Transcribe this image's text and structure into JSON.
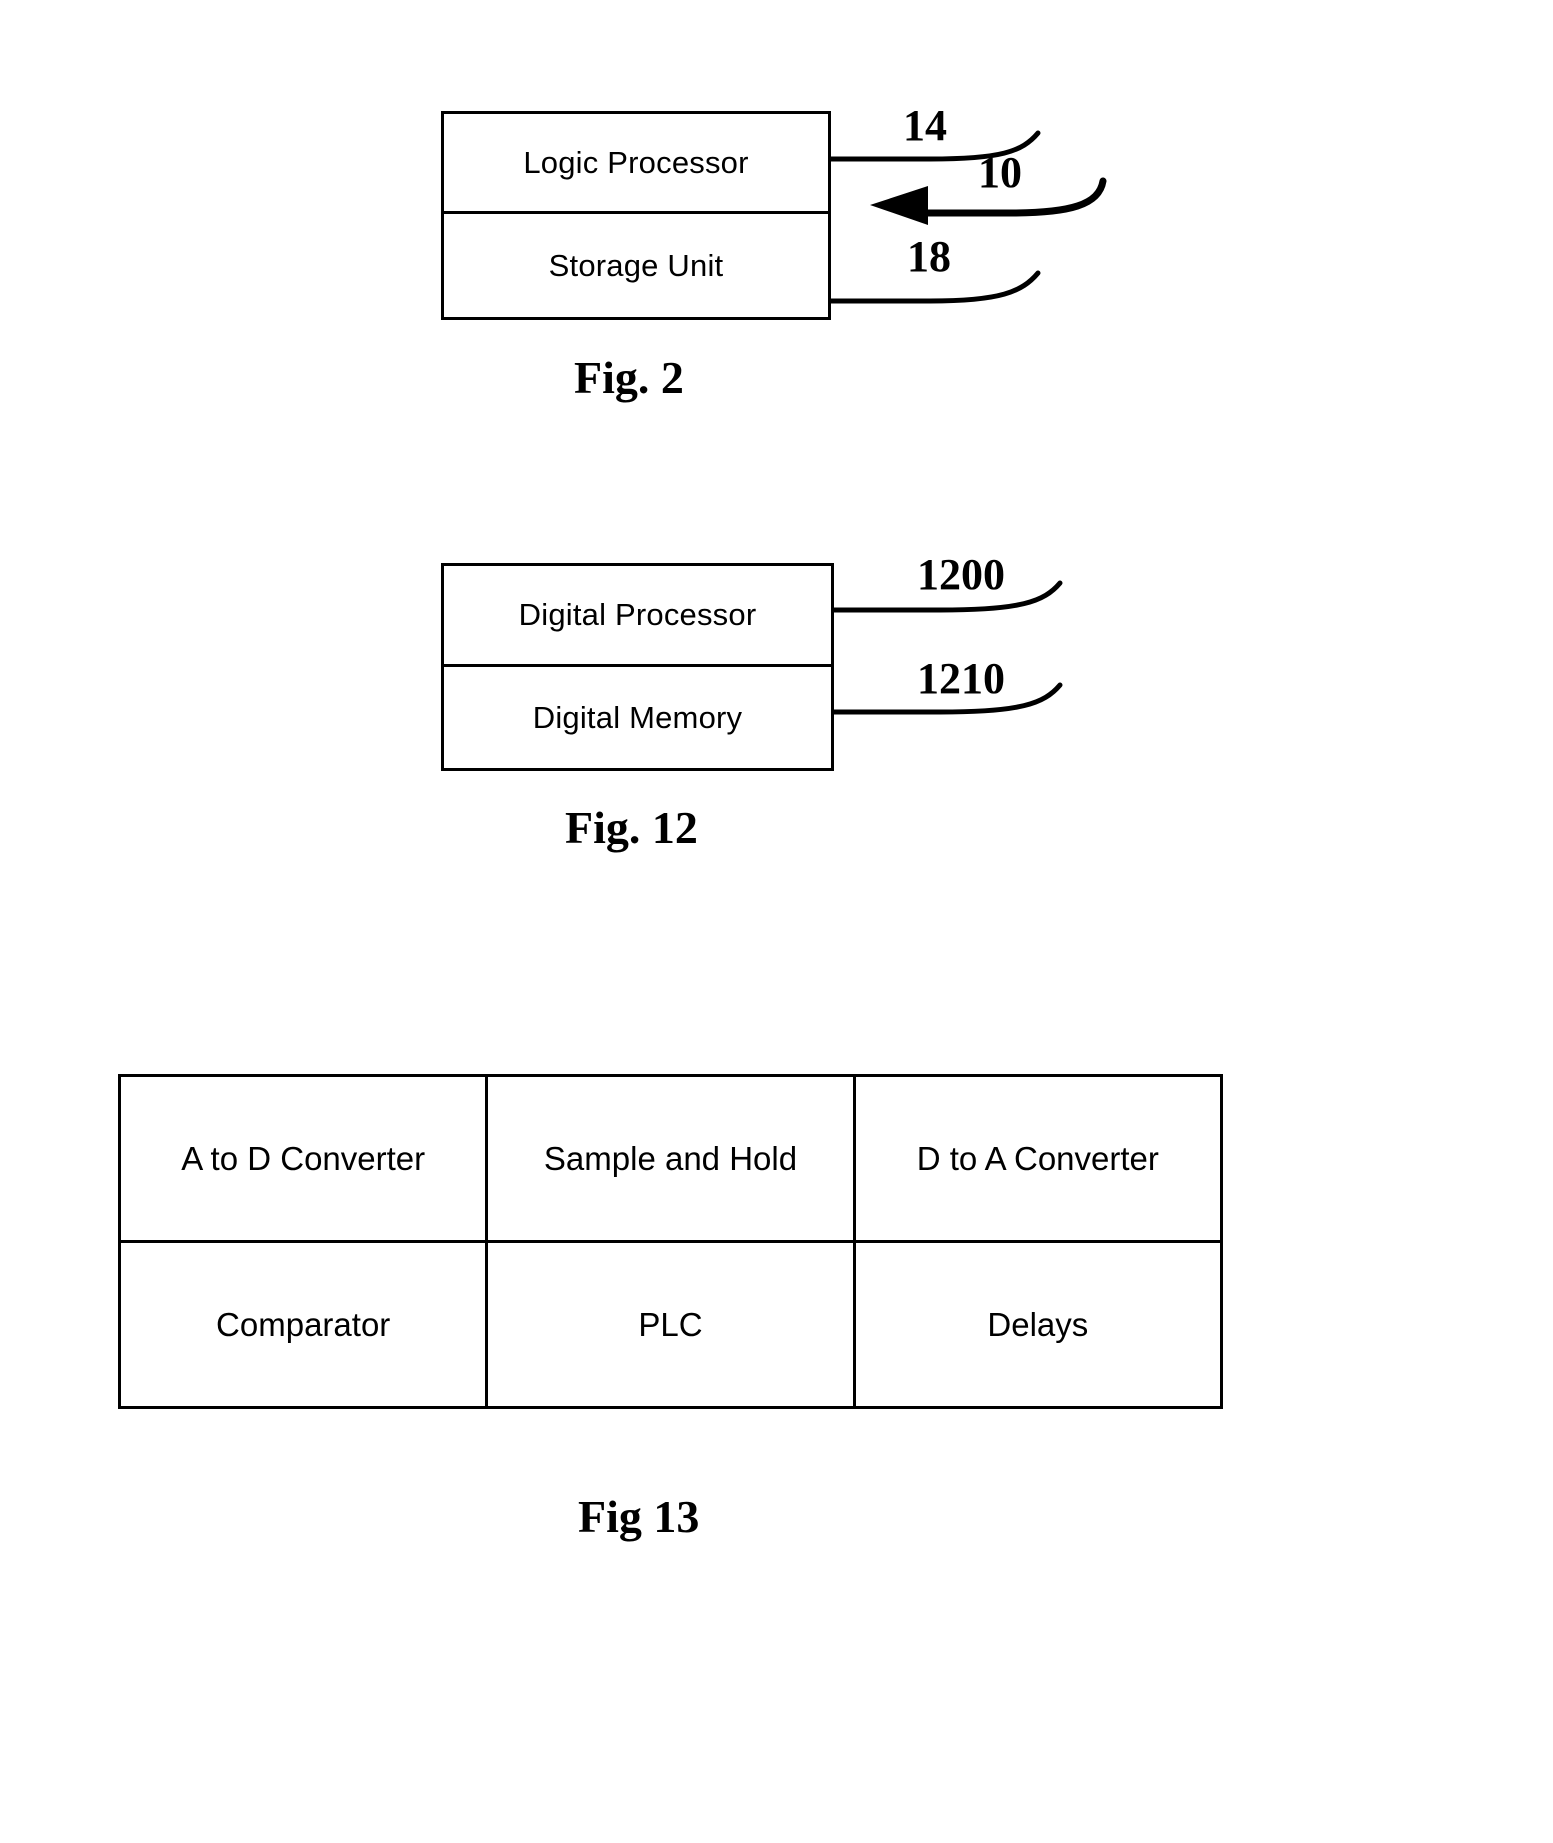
{
  "document": {
    "type": "patent-drawing-sheet",
    "background_color": "#ffffff",
    "line_color": "#000000"
  },
  "figures": [
    {
      "id": "fig-2",
      "caption": "Fig. 2",
      "blocks": [
        {
          "label": "Logic Processor"
        },
        {
          "label": "Storage Unit"
        }
      ],
      "reference_numerals": [
        {
          "value": "14",
          "target": "Logic Processor"
        },
        {
          "value": "10",
          "target": "overall assembly"
        },
        {
          "value": "18",
          "target": "Storage Unit"
        }
      ]
    },
    {
      "id": "fig-12",
      "caption": "Fig. 12",
      "blocks": [
        {
          "label": "Digital Processor"
        },
        {
          "label": "Digital Memory"
        }
      ],
      "reference_numerals": [
        {
          "value": "1200",
          "target": "Digital Processor"
        },
        {
          "value": "1210",
          "target": "Digital Memory"
        }
      ]
    },
    {
      "id": "fig-13",
      "caption": "Fig 13",
      "table": {
        "rows": [
          [
            "A to D Converter",
            "Sample and Hold",
            "D to A Converter"
          ],
          [
            "Comparator",
            "PLC",
            "Delays"
          ]
        ]
      }
    }
  ]
}
